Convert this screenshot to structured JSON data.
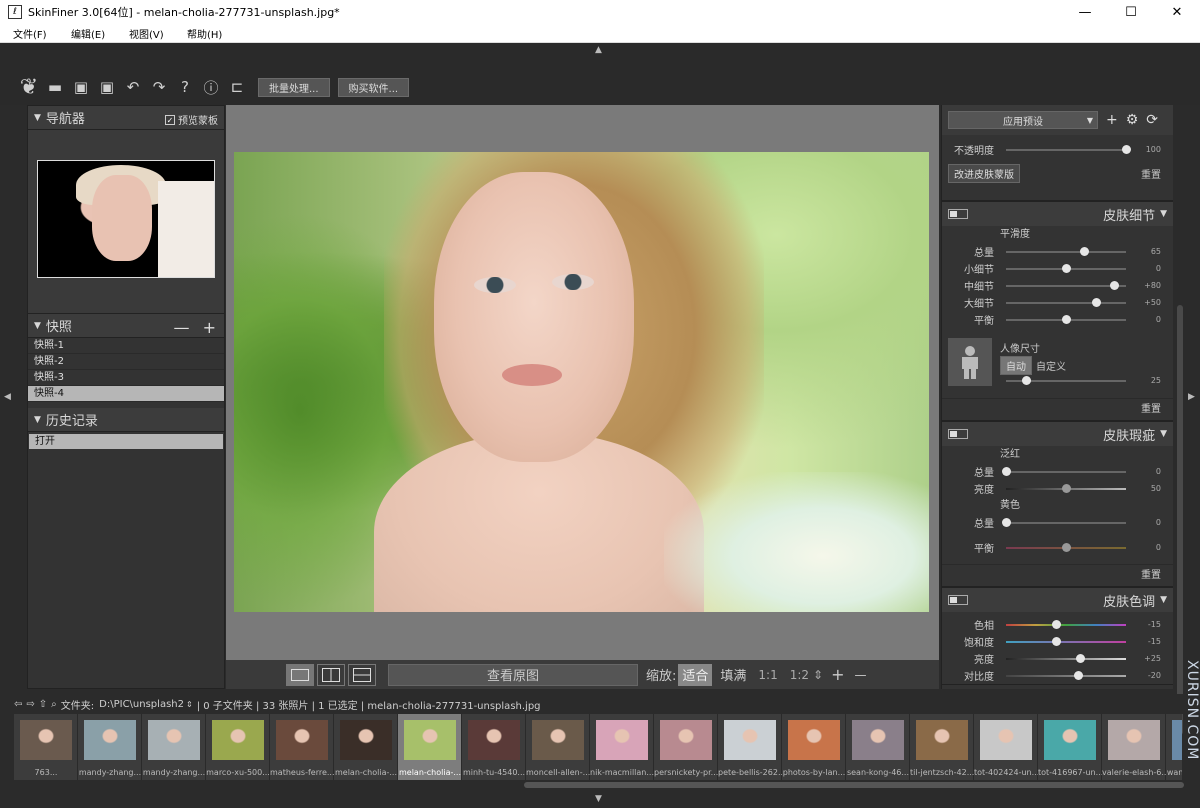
{
  "window": {
    "title": "SkinFiner 3.0[64位] - melan-cholia-277731-unsplash.jpg*",
    "app_icon": "leaf-icon",
    "controls": [
      "—",
      "☐",
      "✕"
    ]
  },
  "menu": [
    "文件(F)",
    "编辑(E)",
    "视图(V)",
    "帮助(H)"
  ],
  "toolbar": {
    "icons": [
      "open-folder-icon",
      "save-icon",
      "save-as-icon",
      "undo-icon",
      "redo-icon",
      "help-icon",
      "info-icon",
      "plugin-icon"
    ],
    "batch_label": "批量处理...",
    "buy_label": "购买软件..."
  },
  "left": {
    "navigator_title": "导航器",
    "preview_mask_label": "预览蒙板",
    "snapshot_title": "快照",
    "snapshot_controls": "— +",
    "snapshots": [
      "快照-1",
      "快照-2",
      "快照-3",
      "快照-4"
    ],
    "selected_snapshot": 3,
    "history_title": "历史记录",
    "history": [
      "打开"
    ]
  },
  "viewbar": {
    "view_original": "查看原图",
    "zoom_label": "缩放:",
    "fit": "适合",
    "fill": "填满",
    "z11": "1:1",
    "z12": "1:2",
    "plus": "+",
    "minus": "—"
  },
  "right": {
    "preset_label": "应用预设",
    "opacity_label": "不透明度",
    "opacity_value": "100",
    "opacity": 100,
    "improve_mask": "改进皮肤蒙版",
    "reset": "重置",
    "skin_detail": {
      "title": "皮肤细节",
      "smooth_label": "平滑度",
      "sliders": [
        {
          "label": "总量",
          "value": "65",
          "pos": 0.65
        },
        {
          "label": "小细节",
          "value": "0",
          "pos": 0.5
        },
        {
          "label": "中细节",
          "value": "+80",
          "pos": 0.9
        },
        {
          "label": "大细节",
          "value": "+50",
          "pos": 0.75
        },
        {
          "label": "平衡",
          "value": "0",
          "pos": 0.5
        }
      ],
      "portrait_size_label": "人像尺寸",
      "auto": "自动",
      "custom": "自定义",
      "size_value": "25",
      "size_pos": 0.17
    },
    "skin_blemish": {
      "title": "皮肤瑕疵",
      "redness_label": "泛红",
      "red_amount": {
        "label": "总量",
        "value": "0",
        "pos": 0.0
      },
      "red_brightness": {
        "label": "亮度",
        "value": "50",
        "pos": 0.5
      },
      "yellow_label": "黄色",
      "yellow_amount": {
        "label": "总量",
        "value": "0",
        "pos": 0.0
      },
      "balance": {
        "label": "平衡",
        "value": "0",
        "pos": 0.5
      }
    },
    "skin_tone": {
      "title": "皮肤色调",
      "sliders": [
        {
          "label": "色相",
          "value": "-15",
          "pos": 0.42
        },
        {
          "label": "饱和度",
          "value": "-15",
          "pos": 0.42
        },
        {
          "label": "亮度",
          "value": "+25",
          "pos": 0.62
        },
        {
          "label": "对比度",
          "value": "-20",
          "pos": 0.6
        }
      ]
    }
  },
  "filebar": {
    "folder_label": "文件夹:",
    "folder": "D:\\PIC\\unsplash2",
    "summary": "| 0 子文件夹 | 33 张照片 | 1 已选定 | melan-cholia-277731-unsplash.jpg"
  },
  "thumbnails": [
    {
      "name": "763...",
      "color": "#6a5a4e"
    },
    {
      "name": "mandy-zhang...",
      "color": "#8aa0a8"
    },
    {
      "name": "mandy-zhang...",
      "color": "#a7b0b4"
    },
    {
      "name": "marco-xu-500...",
      "color": "#9aa84e"
    },
    {
      "name": "matheus-ferre...",
      "color": "#6a4a3c"
    },
    {
      "name": "melan-cholia-...",
      "color": "#3a2e28"
    },
    {
      "name": "melan-cholia-...",
      "color": "#a7c06a"
    },
    {
      "name": "minh-tu-4540...",
      "color": "#5a3a38"
    },
    {
      "name": "moncell-allen-...",
      "color": "#6a5a4a"
    },
    {
      "name": "nik-macmillan...",
      "color": "#d8a4b8"
    },
    {
      "name": "persnickety-pr...",
      "color": "#b88a90"
    },
    {
      "name": "pete-bellis-262...",
      "color": "#cbd0d4"
    },
    {
      "name": "photos-by-lan...",
      "color": "#c8744a"
    },
    {
      "name": "sean-kong-46...",
      "color": "#8a7f8a"
    },
    {
      "name": "til-jentzsch-42...",
      "color": "#8a6a48"
    },
    {
      "name": "tot-402424-un...",
      "color": "#c8c8c8"
    },
    {
      "name": "tot-416967-un...",
      "color": "#4aa8a8"
    },
    {
      "name": "valerie-elash-6...",
      "color": "#b4a8a8"
    },
    {
      "name": "wang-xi-6779...",
      "color": "#6a8aa8"
    }
  ],
  "selected_thumbnail": 6,
  "watermark": "XURISN.COM"
}
